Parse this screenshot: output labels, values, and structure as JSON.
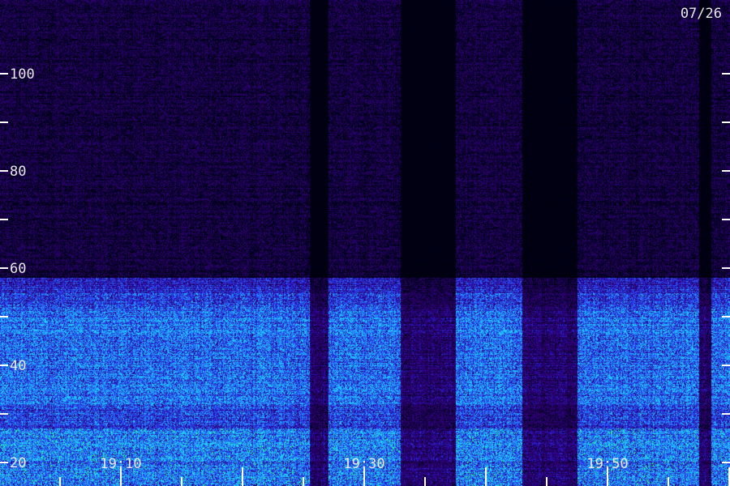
{
  "chart_data": {
    "type": "heatmap",
    "title": "",
    "date": "07/26",
    "xlabel": "",
    "ylabel": "",
    "y_ticks": [
      100,
      80,
      60,
      40,
      20
    ],
    "y_minor_ticks": [
      90,
      70,
      50,
      30,
      10
    ],
    "ylim": [
      0,
      100
    ],
    "x_tick_labels": [
      "19:10",
      "19:30",
      "19:50"
    ],
    "x_tick_minutes": [
      10,
      30,
      50
    ],
    "xlim_minutes": [
      0,
      60
    ],
    "colormap": [
      "#000000",
      "#1a0050",
      "#2a18b0",
      "#2f5cff",
      "#22d8ff",
      "#40ff70"
    ],
    "bands": [
      {
        "from": 0,
        "to": 5,
        "level": "very high, green/cyan streaks"
      },
      {
        "from": 5,
        "to": 17,
        "level": "high, cyan/green streaks"
      },
      {
        "from": 17,
        "to": 22,
        "level": "medium"
      },
      {
        "from": 22,
        "to": 48,
        "level": "elevated, bright blue"
      },
      {
        "from": 48,
        "to": 100,
        "level": "low, dark violet background noise"
      }
    ],
    "dark_vertical_stripes_minutes": [
      [
        25.5,
        27
      ],
      [
        33,
        37.5
      ],
      [
        43,
        47.5
      ],
      [
        57.5,
        58.5
      ]
    ]
  }
}
